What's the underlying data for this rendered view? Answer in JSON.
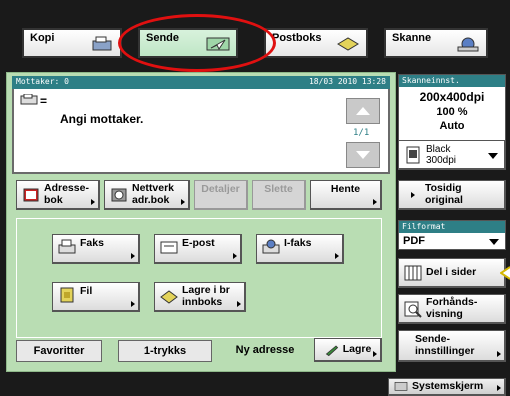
{
  "tabs": {
    "kopi": "Kopi",
    "sende": "Sende",
    "postboks": "Postboks",
    "skanne": "Skanne"
  },
  "recipients": {
    "header_label": "Mottaker: 0",
    "datetime": "18/03 2010 13:28",
    "prefix": "=",
    "prompt": "Angi mottaker.",
    "page": "1/1"
  },
  "actions": {
    "address_book": "Adresse- bok",
    "network_address_book": "Nettverk adr.bok",
    "details": "Detaljer",
    "delete": "Slette",
    "retrieve": "Hente"
  },
  "send_types": {
    "fax": "Faks",
    "email": "E-post",
    "ifax": "I-faks",
    "file": "Fil",
    "store_in_inbox": "Lagre i br innboks"
  },
  "bottom_tabs": {
    "favorites": "Favoritter",
    "one_touch": "1-trykks",
    "new_address": "Ny adresse",
    "save": "Lagre"
  },
  "scan_settings": {
    "header": "Skanneinnst.",
    "resolution": "200x400dpi",
    "zoom": "100 %",
    "mode": "Auto",
    "color_line1": "Black",
    "color_line2": "300dpi"
  },
  "right_buttons": {
    "two_sided": "Tosidig original",
    "file_format_header": "Filformat",
    "file_format_value": "PDF",
    "split_pages": "Del i sider",
    "preview": "Forhånds- visning",
    "send_settings": "Sende- innstillinger"
  },
  "status_bar": {
    "system_monitor": "Systemskjerm"
  },
  "colors": {
    "panel_green": "#b9ddb3",
    "header_teal": "#2e7f86",
    "highlight_red": "#e01010"
  }
}
